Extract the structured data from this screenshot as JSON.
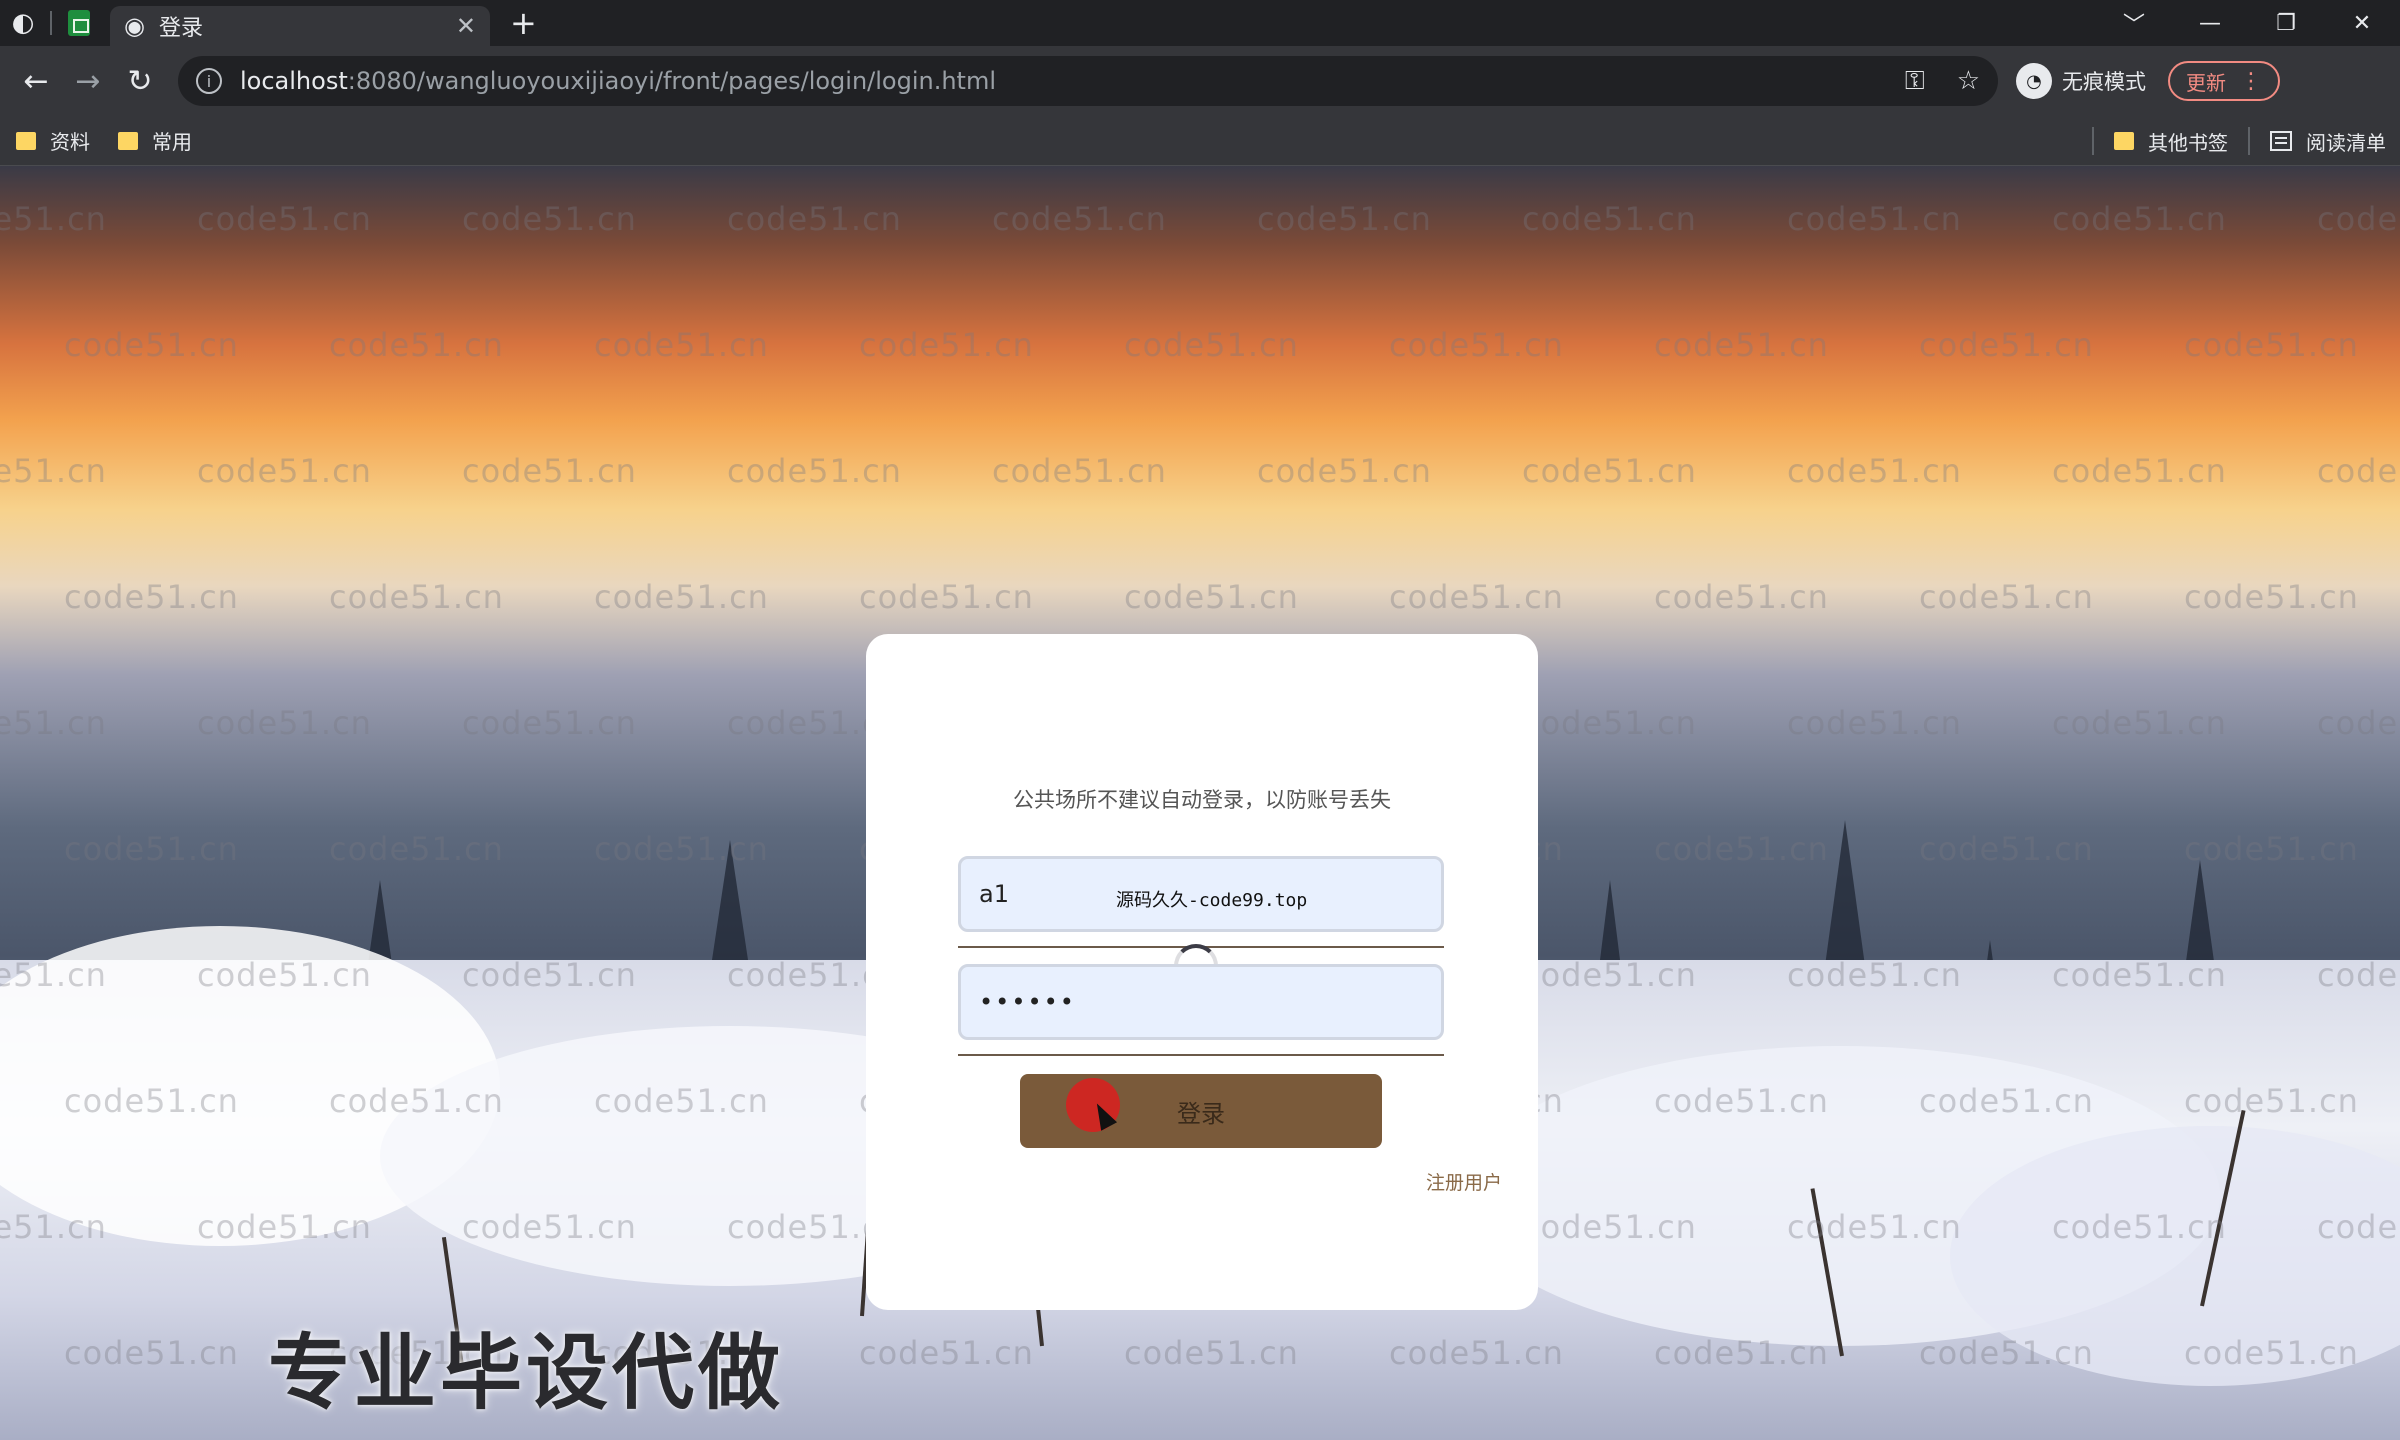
{
  "browser": {
    "tab_title": "登录",
    "tab_close": "✕",
    "new_tab": "+",
    "url_host": "localhost",
    "url_rest": ":8080/wangluoyouxijiaoyi/front/pages/login/login.html",
    "incognito_label": "无痕模式",
    "update_label": "更新",
    "window_controls": [
      "﹀",
      "—",
      "❐",
      "✕"
    ]
  },
  "bookmarks": {
    "left": [
      "资料",
      "常用"
    ],
    "other": "其他书签",
    "reading_list": "阅读清单"
  },
  "login": {
    "notice": "公共场所不建议自动登录，以防账号丢失",
    "username_value": "a1",
    "password_mask": "••••••",
    "overlay_text": "源码久久-code99.top",
    "button_label": "登录",
    "register_link": "注册用户"
  },
  "overlay": {
    "watermark": "code51.cn",
    "ad_text": "专业毕设代做"
  },
  "colors": {
    "button_bg": "#7a5a3a",
    "field_bg": "#e8f0fe",
    "chrome_dark": "#202124",
    "chrome_toolbar": "#35363a"
  },
  "icons": [
    "chrome-icon",
    "sheets-icon",
    "globe-icon",
    "back-icon",
    "forward-icon",
    "reload-icon",
    "info-icon",
    "key-icon",
    "star-icon",
    "incognito-icon",
    "menu-dots-icon",
    "folder-icon",
    "reading-list-icon"
  ]
}
